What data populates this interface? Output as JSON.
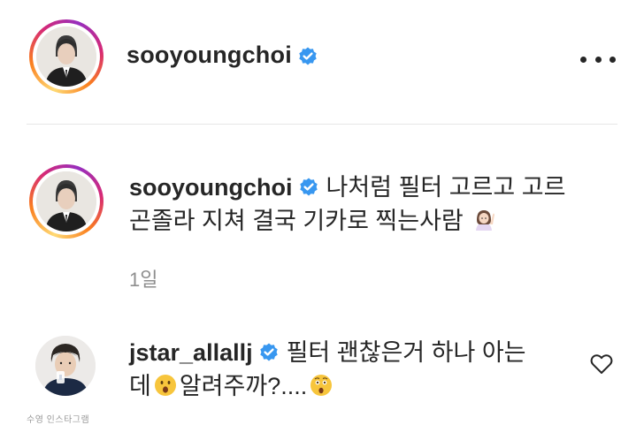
{
  "post_header": {
    "username": "sooyoungchoi",
    "verified": true,
    "more_label": "..."
  },
  "caption": {
    "username": "sooyoungchoi",
    "verified": true,
    "text_line1": "나처럼 필터 고르고 고르",
    "text_line2": "곤졸라 지쳐 결국 기카로 찍는사람",
    "emoji": "woman-raising-hand",
    "time": "1일"
  },
  "reply": {
    "username": "jstar_allallj",
    "verified": true,
    "text_part1": "필터 괜찮은거 하나 아는",
    "text_part2_a": "데",
    "text_part2_b": "알려주까?....",
    "emoji_1": "surprised-face",
    "emoji_2": "astonished-face",
    "like_icon": "heart-outline-icon"
  },
  "watermark": "수영 인스타그램",
  "colors": {
    "text": "#262626",
    "secondary": "#8e8e8e",
    "verified": "#3897f0",
    "ring_start": "#feda75",
    "ring_end": "#962fbf"
  }
}
